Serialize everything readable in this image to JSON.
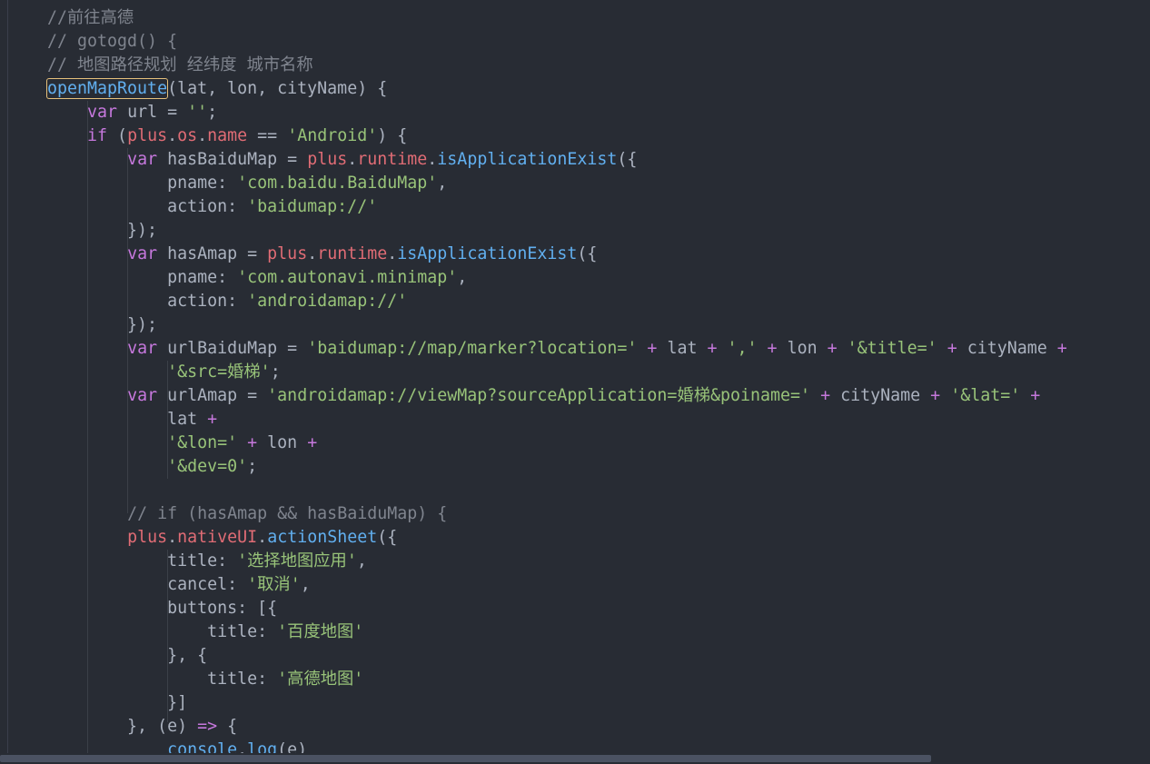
{
  "colors": {
    "background": "#282c34",
    "comment": "#7f848e",
    "function": "#61afef",
    "keyword": "#c678dd",
    "variable": "#e06c75",
    "string": "#98c379",
    "plain": "#abb2bf",
    "match_outline": "#e5c07b"
  },
  "code": {
    "lines": [
      [
        {
          "t": "//前往高德",
          "c": "comment"
        }
      ],
      [
        {
          "t": "// gotogd() {",
          "c": "comment"
        }
      ],
      [
        {
          "t": "// 地图路径规划 经纬度 城市名称",
          "c": "comment"
        }
      ],
      [
        {
          "t": "openMapRoute",
          "c": "func",
          "m": true
        },
        {
          "t": "(lat, lon, cityName) {",
          "c": "plain"
        }
      ],
      [
        {
          "t": "    ",
          "c": "plain"
        },
        {
          "t": "var",
          "c": "kw"
        },
        {
          "t": " url = ",
          "c": "plain"
        },
        {
          "t": "''",
          "c": "str"
        },
        {
          "t": ";",
          "c": "plain"
        }
      ],
      [
        {
          "t": "    ",
          "c": "plain"
        },
        {
          "t": "if",
          "c": "kw"
        },
        {
          "t": " (",
          "c": "plain"
        },
        {
          "t": "plus",
          "c": "var"
        },
        {
          "t": ".",
          "c": "plain"
        },
        {
          "t": "os",
          "c": "var"
        },
        {
          "t": ".",
          "c": "plain"
        },
        {
          "t": "name",
          "c": "var"
        },
        {
          "t": " == ",
          "c": "plain"
        },
        {
          "t": "'Android'",
          "c": "str"
        },
        {
          "t": ") {",
          "c": "plain"
        }
      ],
      [
        {
          "t": "        ",
          "c": "plain"
        },
        {
          "t": "var",
          "c": "kw"
        },
        {
          "t": " hasBaiduMap = ",
          "c": "plain"
        },
        {
          "t": "plus",
          "c": "var"
        },
        {
          "t": ".",
          "c": "plain"
        },
        {
          "t": "runtime",
          "c": "var"
        },
        {
          "t": ".",
          "c": "plain"
        },
        {
          "t": "isApplicationExist",
          "c": "func"
        },
        {
          "t": "({",
          "c": "plain"
        }
      ],
      [
        {
          "t": "            pname: ",
          "c": "plain"
        },
        {
          "t": "'com.baidu.BaiduMap'",
          "c": "str"
        },
        {
          "t": ",",
          "c": "plain"
        }
      ],
      [
        {
          "t": "            action: ",
          "c": "plain"
        },
        {
          "t": "'baidumap://'",
          "c": "str"
        }
      ],
      [
        {
          "t": "        });",
          "c": "plain"
        }
      ],
      [
        {
          "t": "        ",
          "c": "plain"
        },
        {
          "t": "var",
          "c": "kw"
        },
        {
          "t": " hasAmap = ",
          "c": "plain"
        },
        {
          "t": "plus",
          "c": "var"
        },
        {
          "t": ".",
          "c": "plain"
        },
        {
          "t": "runtime",
          "c": "var"
        },
        {
          "t": ".",
          "c": "plain"
        },
        {
          "t": "isApplicationExist",
          "c": "func"
        },
        {
          "t": "({",
          "c": "plain"
        }
      ],
      [
        {
          "t": "            pname: ",
          "c": "plain"
        },
        {
          "t": "'com.autonavi.minimap'",
          "c": "str"
        },
        {
          "t": ",",
          "c": "plain"
        }
      ],
      [
        {
          "t": "            action: ",
          "c": "plain"
        },
        {
          "t": "'androidamap://'",
          "c": "str"
        }
      ],
      [
        {
          "t": "        });",
          "c": "plain"
        }
      ],
      [
        {
          "t": "        ",
          "c": "plain"
        },
        {
          "t": "var",
          "c": "kw"
        },
        {
          "t": " urlBaiduMap = ",
          "c": "plain"
        },
        {
          "t": "'baidumap://map/marker?location='",
          "c": "str"
        },
        {
          "t": " + ",
          "c": "op"
        },
        {
          "t": "lat",
          "c": "plain"
        },
        {
          "t": " + ",
          "c": "op"
        },
        {
          "t": "','",
          "c": "str"
        },
        {
          "t": " + ",
          "c": "op"
        },
        {
          "t": "lon",
          "c": "plain"
        },
        {
          "t": " + ",
          "c": "op"
        },
        {
          "t": "'&title='",
          "c": "str"
        },
        {
          "t": " + ",
          "c": "op"
        },
        {
          "t": "cityName",
          "c": "plain"
        },
        {
          "t": " +",
          "c": "op"
        }
      ],
      [
        {
          "t": "            ",
          "c": "plain"
        },
        {
          "t": "'&src=婚梯'",
          "c": "str"
        },
        {
          "t": ";",
          "c": "plain"
        }
      ],
      [
        {
          "t": "        ",
          "c": "plain"
        },
        {
          "t": "var",
          "c": "kw"
        },
        {
          "t": " urlAmap = ",
          "c": "plain"
        },
        {
          "t": "'androidamap://viewMap?sourceApplication=婚梯&poiname='",
          "c": "str"
        },
        {
          "t": " + ",
          "c": "op"
        },
        {
          "t": "cityName",
          "c": "plain"
        },
        {
          "t": " + ",
          "c": "op"
        },
        {
          "t": "'&lat='",
          "c": "str"
        },
        {
          "t": " +",
          "c": "op"
        }
      ],
      [
        {
          "t": "            lat",
          "c": "plain"
        },
        {
          "t": " +",
          "c": "op"
        }
      ],
      [
        {
          "t": "            ",
          "c": "plain"
        },
        {
          "t": "'&lon='",
          "c": "str"
        },
        {
          "t": " + ",
          "c": "op"
        },
        {
          "t": "lon",
          "c": "plain"
        },
        {
          "t": " +",
          "c": "op"
        }
      ],
      [
        {
          "t": "            ",
          "c": "plain"
        },
        {
          "t": "'&dev=0'",
          "c": "str"
        },
        {
          "t": ";",
          "c": "plain"
        }
      ],
      [
        {
          "t": "",
          "c": "plain"
        }
      ],
      [
        {
          "t": "        ",
          "c": "plain"
        },
        {
          "t": "// if (hasAmap && hasBaiduMap) {",
          "c": "comment"
        }
      ],
      [
        {
          "t": "        ",
          "c": "plain"
        },
        {
          "t": "plus",
          "c": "var"
        },
        {
          "t": ".",
          "c": "plain"
        },
        {
          "t": "nativeUI",
          "c": "var"
        },
        {
          "t": ".",
          "c": "plain"
        },
        {
          "t": "actionSheet",
          "c": "func"
        },
        {
          "t": "({",
          "c": "plain"
        }
      ],
      [
        {
          "t": "            title: ",
          "c": "plain"
        },
        {
          "t": "'选择地图应用'",
          "c": "str"
        },
        {
          "t": ",",
          "c": "plain"
        }
      ],
      [
        {
          "t": "            cancel: ",
          "c": "plain"
        },
        {
          "t": "'取消'",
          "c": "str"
        },
        {
          "t": ",",
          "c": "plain"
        }
      ],
      [
        {
          "t": "            buttons: [{",
          "c": "plain"
        }
      ],
      [
        {
          "t": "                title: ",
          "c": "plain"
        },
        {
          "t": "'百度地图'",
          "c": "str"
        }
      ],
      [
        {
          "t": "            }, {",
          "c": "plain"
        }
      ],
      [
        {
          "t": "                title: ",
          "c": "plain"
        },
        {
          "t": "'高德地图'",
          "c": "str"
        }
      ],
      [
        {
          "t": "            }]",
          "c": "plain"
        }
      ],
      [
        {
          "t": "        }, (e) ",
          "c": "plain"
        },
        {
          "t": "=>",
          "c": "op"
        },
        {
          "t": " {",
          "c": "plain"
        }
      ],
      [
        {
          "t": "            ",
          "c": "plain"
        },
        {
          "t": "console",
          "c": "func"
        },
        {
          "t": ".",
          "c": "plain"
        },
        {
          "t": "log",
          "c": "func"
        },
        {
          "t": "(e)",
          "c": "plain"
        }
      ]
    ]
  }
}
